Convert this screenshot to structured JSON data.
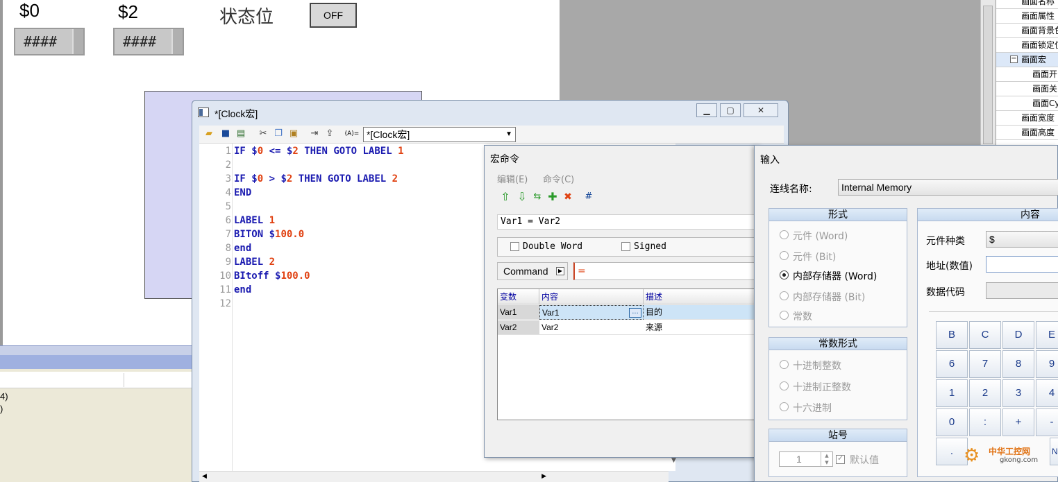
{
  "canvas": {
    "label_s0": "$0",
    "label_s2": "$2",
    "status_label": "状态位",
    "hash_value_1": "####",
    "hash_value_2": "####",
    "off_button": "OFF"
  },
  "property_panel": {
    "items": [
      "画面名称",
      "画面属性",
      "画面背景色",
      "画面锁定位",
      "画面宏",
      "画面开",
      "画面关",
      "画面Cy",
      "画面宽度",
      "画面高度"
    ],
    "expand_toggle": "−"
  },
  "bottom_panel": {
    "line1": "4)",
    "line2": ")"
  },
  "clock_window": {
    "title": "*[Clock宏]",
    "combo_value": "*[Clock宏]",
    "toolbar_var_label": "(A)=",
    "line_numbers": [
      "1",
      "2",
      "3",
      "4",
      "5",
      "6",
      "7",
      "8",
      "9",
      "10",
      "11",
      "12"
    ],
    "code_lines": [
      [
        {
          "t": "IF ",
          "c": "kw"
        },
        {
          "t": "$",
          "c": "kw"
        },
        {
          "t": "0",
          "c": "num"
        },
        {
          "t": " <= ",
          "c": "op"
        },
        {
          "t": "$",
          "c": "kw"
        },
        {
          "t": "2",
          "c": "num"
        },
        {
          "t": " THEN GOTO LABEL ",
          "c": "kw"
        },
        {
          "t": "1",
          "c": "num"
        }
      ],
      [],
      [
        {
          "t": "IF ",
          "c": "kw"
        },
        {
          "t": "$",
          "c": "kw"
        },
        {
          "t": "0",
          "c": "num"
        },
        {
          "t": " > ",
          "c": "op"
        },
        {
          "t": "$",
          "c": "kw"
        },
        {
          "t": "2",
          "c": "num"
        },
        {
          "t": " THEN GOTO LABEL ",
          "c": "kw"
        },
        {
          "t": "2",
          "c": "num"
        }
      ],
      [
        {
          "t": "END",
          "c": "kw"
        }
      ],
      [],
      [
        {
          "t": "LABEL ",
          "c": "kw"
        },
        {
          "t": "1",
          "c": "num"
        }
      ],
      [
        {
          "t": "BITON ",
          "c": "kw"
        },
        {
          "t": "$",
          "c": "kw"
        },
        {
          "t": "100.0",
          "c": "num"
        }
      ],
      [
        {
          "t": "end",
          "c": "kw"
        }
      ],
      [
        {
          "t": "LABEL ",
          "c": "kw"
        },
        {
          "t": "2",
          "c": "num"
        }
      ],
      [
        {
          "t": "BItoff ",
          "c": "kw"
        },
        {
          "t": "$",
          "c": "kw"
        },
        {
          "t": "100.0",
          "c": "num"
        }
      ],
      [
        {
          "t": "end",
          "c": "kw"
        }
      ],
      []
    ]
  },
  "macro_dialog": {
    "title": "宏命令",
    "menu_edit": "编辑(E)",
    "menu_command": "命令(C)",
    "hash_icon": "#",
    "expression": "Var1 = Var2",
    "double_word": "Double Word",
    "signed": "Signed",
    "command_button": "Command",
    "command_field": "=",
    "columns": [
      "变数",
      "内容",
      "描述"
    ],
    "rows": [
      {
        "var": "Var1",
        "content": "Var1",
        "desc": "目的"
      },
      {
        "var": "Var2",
        "content": "Var2",
        "desc": "来源"
      }
    ],
    "ellipsis": "..."
  },
  "input_dialog": {
    "title": "输入",
    "conn_label": "连线名称:",
    "conn_value": "Internal Memory",
    "form_header": "形式",
    "form_options": [
      "元件 (Word)",
      "元件 (Bit)",
      "内部存储器 (Word)",
      "内部存储器 (Bit)",
      "常数"
    ],
    "form_selected": 2,
    "const_header": "常数形式",
    "const_options": [
      "十进制整数",
      "十进制正整数",
      "十六进制"
    ],
    "station_header": "站号",
    "station_value": "1",
    "default_label": "默认值",
    "content_header": "内容",
    "element_type_label": "元件种类",
    "element_type_value": "$",
    "address_label": "地址(数值)",
    "data_code_label": "数据代码",
    "keypad": [
      [
        "B",
        "C",
        "D",
        "E"
      ],
      [
        "6",
        "7",
        "8",
        "9"
      ],
      [
        "1",
        "2",
        "3",
        "4"
      ],
      [
        "0",
        ":",
        "+",
        "-"
      ]
    ],
    "keypad_last": ".",
    "keypad_partial": "No"
  },
  "watermark": {
    "line1": "中华工控网",
    "line2": "gkong.com"
  },
  "colors": {
    "keyword": "#1a1ab0",
    "number": "#e04010",
    "selected_row": "#cde4f7",
    "purple_panel": "#d6d6f4"
  }
}
